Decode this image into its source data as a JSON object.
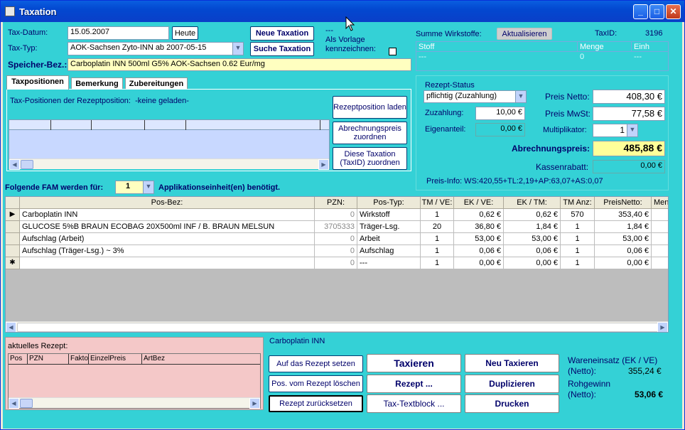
{
  "window": {
    "title": "Taxation"
  },
  "header": {
    "tax_datum_label": "Tax-Datum:",
    "tax_datum_value": "15.05.2007",
    "heute_button": "Heute",
    "tax_typ_label": "Tax-Typ:",
    "tax_typ_value": "AOK-Sachsen Zyto-INN ab 2007-05-15",
    "neue_taxation_button": "Neue Taxation",
    "suche_taxation_button": "Suche Taxation",
    "dash": "---",
    "als_vorlage_label": "Als Vorlage kennzeichnen:",
    "speicher_label": "Speicher-Bez.:",
    "speicher_value": "Carboplatin INN 500ml G5% AOK-Sachsen 0.62 Eur/mg"
  },
  "wirkstoffe": {
    "label": "Summe Wirkstoffe:",
    "aktualisieren_button": "Aktualisieren",
    "taxid_label": "TaxID:",
    "taxid_value": "3196",
    "col_stoff": "Stoff",
    "col_menge": "Menge",
    "col_einh": "Einh",
    "row_stoff": "---",
    "row_menge": "0",
    "row_einh": "---"
  },
  "tabs": {
    "items": [
      "Taxpositionen",
      "Bemerkung",
      "Zubereitungen"
    ],
    "tax_positionen_text": "Tax-Positionen der Rezeptposition:",
    "keine_geladen": "-keine geladen-",
    "rezeptposition_laden": "Rezeptposition laden",
    "abrechnungspreis_zuordnen": "Abrechnungspreis zuordnen",
    "taxation_zuordnen": "Diese Taxation (TaxID) zuordnen"
  },
  "rezept_status": {
    "title": "Rezept-Status",
    "status_value": "pflichtig (Zuzahlung)",
    "zuzahlung_label": "Zuzahlung:",
    "zuzahlung_value": "10,00 €",
    "eigenanteil_label": "Eigenanteil:",
    "eigenanteil_value": "0,00 €",
    "preis_netto_label": "Preis Netto:",
    "preis_netto_value": "408,30 €",
    "preis_mwst_label": "Preis MwSt:",
    "preis_mwst_value": "77,58 €",
    "multiplikator_label": "Multiplikator:",
    "multiplikator_value": "1",
    "abrechnungspreis_label": "Abrechnungspreis:",
    "abrechnungspreis_value": "485,88 €",
    "kassenrabatt_label": "Kassenrabatt:",
    "kassenrabatt_value": "0,00 €",
    "preis_info": "Preis-Info:  WS:420,55+TL:2,19+AP:63,07+AS:0,07"
  },
  "fam": {
    "label_before": "Folgende FAM werden für:",
    "count": "1",
    "label_after": "Applikationseinheit(en) benötigt."
  },
  "table": {
    "columns": [
      "Pos-Bez:",
      "PZN:",
      "Pos-Typ:",
      "TM / VE:",
      "EK / VE:",
      "EK / TM:",
      "TM Anz:",
      "PreisNetto:",
      "Men"
    ],
    "rows": [
      {
        "bez": "Carboplatin INN",
        "pzn": "0",
        "typ": "Wirkstoff",
        "tmve": "1",
        "ekve": "0,62 €",
        "ektm": "0,62 €",
        "tmanz": "570",
        "netto": "353,40 €",
        "selected": true
      },
      {
        "bez": "GLUCOSE 5%B BRAUN ECOBAG  20X500ml INF  / B. BRAUN MELSUN",
        "pzn": "3705333",
        "typ": "Träger-Lsg.",
        "tmve": "20",
        "ekve": "36,80 €",
        "ektm": "1,84 €",
        "tmanz": "1",
        "netto": "1,84 €",
        "selected": false
      },
      {
        "bez": "Aufschlag (Arbeit)",
        "pzn": "0",
        "typ": "Arbeit",
        "tmve": "1",
        "ekve": "53,00 €",
        "ektm": "53,00 €",
        "tmanz": "1",
        "netto": "53,00 €",
        "selected": false
      },
      {
        "bez": "Aufschlag (Träger-Lsg.) ~ 3%",
        "pzn": "0",
        "typ": "Aufschlag",
        "tmve": "1",
        "ekve": "0,06 €",
        "ektm": "0,06 €",
        "tmanz": "1",
        "netto": "0,06 €",
        "selected": false
      },
      {
        "bez": "",
        "pzn": "0",
        "typ": "---",
        "tmve": "1",
        "ekve": "0,00 €",
        "ektm": "0,00 €",
        "tmanz": "1",
        "netto": "0,00 €",
        "selected": false
      }
    ]
  },
  "aktuelles_rezept": {
    "label": "aktuelles Rezept:",
    "columns": [
      "Pos",
      "PZN",
      "Faktor",
      "EinzelPreis",
      "ArtBez"
    ]
  },
  "bottom": {
    "drug_name": "Carboplatin INN",
    "auf_rezept": "Auf das Rezept setzen",
    "pos_loeschen": "Pos. vom Rezept löschen",
    "rezept_zuruecksetzen": "Rezept zurücksetzen",
    "taxieren": "Taxieren",
    "rezept": "Rezept ...",
    "tax_textblock": "Tax-Textblock ...",
    "neu_taxieren": "Neu Taxieren",
    "duplizieren": "Duplizieren",
    "drucken": "Drucken",
    "wareneinsatz_label": "Wareneinsatz (EK / VE)",
    "netto_label1": "(Netto):",
    "wareneinsatz_value": "355,24 €",
    "rohgewinn_label": "Rohgewinn",
    "netto_label2": "(Netto):",
    "rohgewinn_value": "53,06 €"
  }
}
